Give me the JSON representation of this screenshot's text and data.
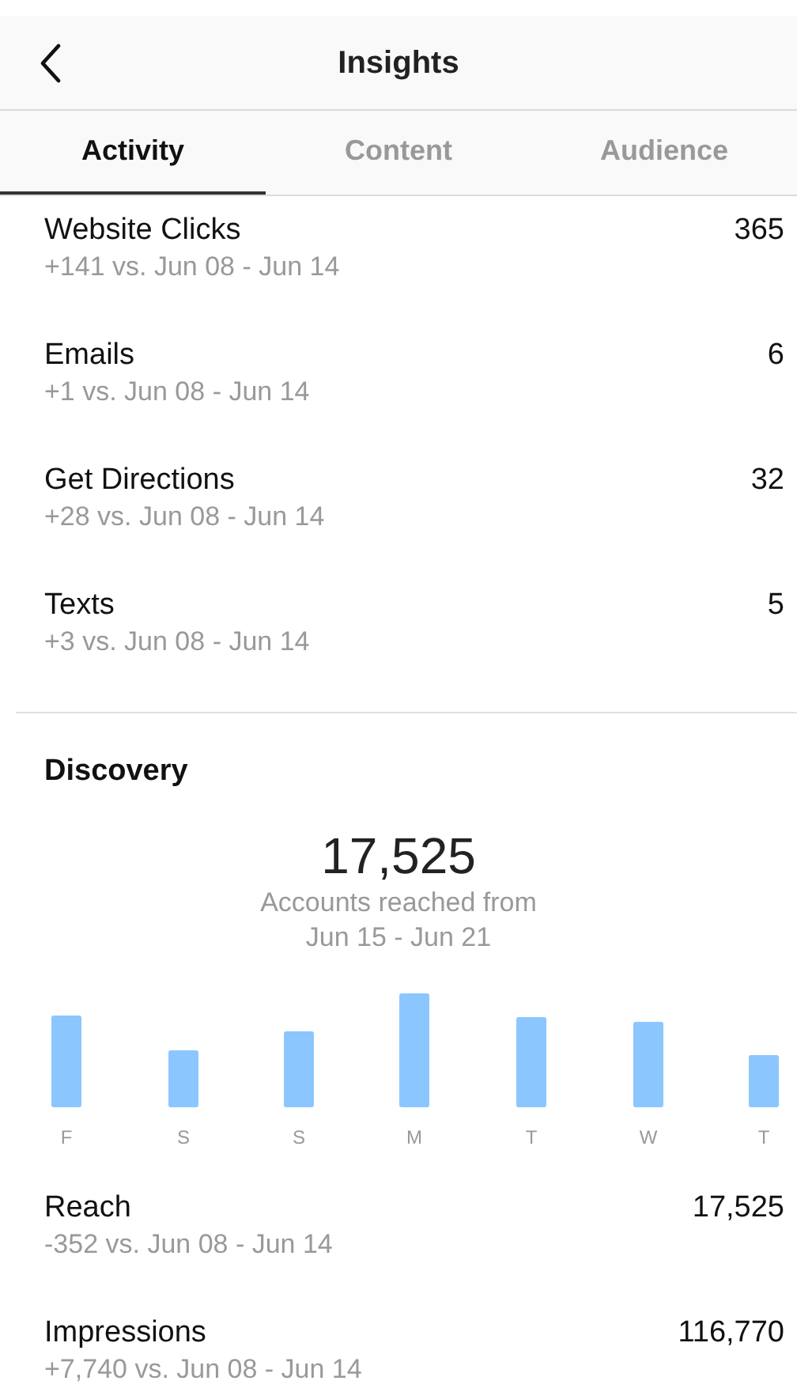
{
  "header": {
    "title": "Insights"
  },
  "tabs": [
    {
      "label": "Activity",
      "selected": true
    },
    {
      "label": "Content",
      "selected": false
    },
    {
      "label": "Audience",
      "selected": false
    }
  ],
  "metrics": [
    {
      "label": "Website Clicks",
      "value": "365",
      "comparison": "+141 vs. Jun 08 - Jun 14"
    },
    {
      "label": "Emails",
      "value": "6",
      "comparison": "+1 vs. Jun 08 - Jun 14"
    },
    {
      "label": "Get Directions",
      "value": "32",
      "comparison": "+28 vs. Jun 08 - Jun 14"
    },
    {
      "label": "Texts",
      "value": "5",
      "comparison": "+3 vs. Jun 08 - Jun 14"
    }
  ],
  "discovery": {
    "heading": "Discovery",
    "total": "17,525",
    "caption_line_1": "Accounts reached from",
    "caption_line_2": "Jun 15 - Jun 21",
    "day_labels": [
      "F",
      "S",
      "S",
      "M",
      "T",
      "W",
      "T"
    ],
    "metrics": [
      {
        "label": "Reach",
        "value": "17,525",
        "comparison": "-352 vs. Jun 08 - Jun 14"
      },
      {
        "label": "Impressions",
        "value": "116,770",
        "comparison": "+7,740 vs. Jun 08 - Jun 14"
      }
    ]
  }
}
